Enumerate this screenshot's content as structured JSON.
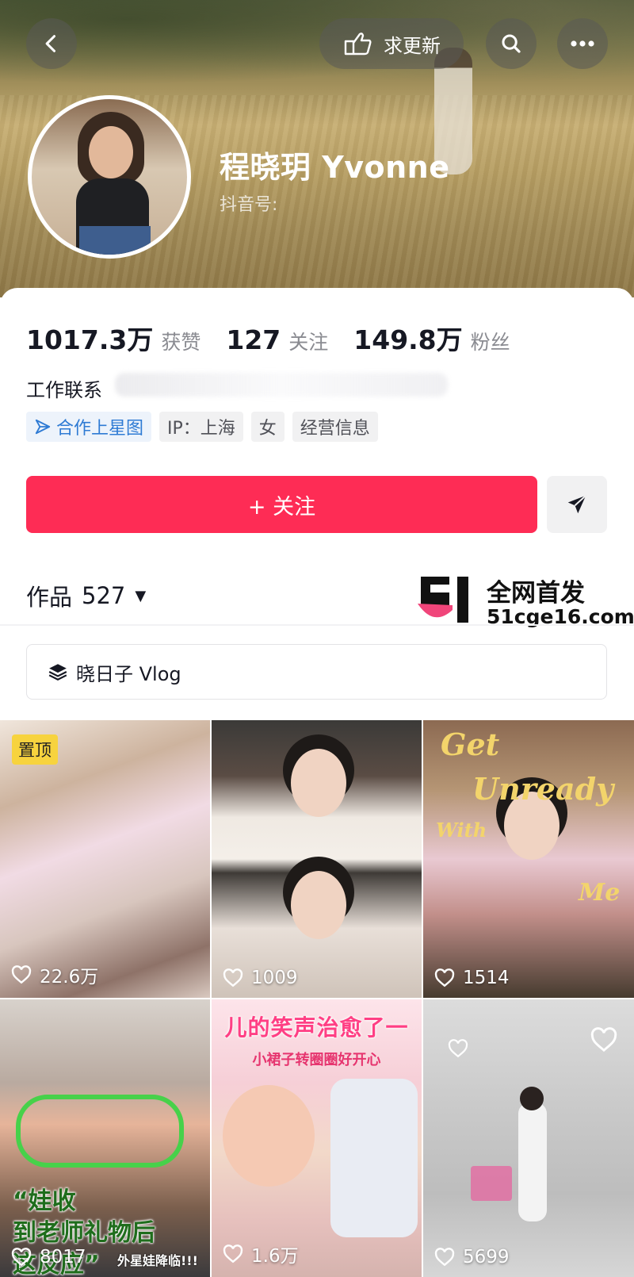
{
  "header": {
    "update_label": "求更新",
    "username": "程晓玥 Yvonne",
    "douyin_id_label": "抖音号:"
  },
  "stats": [
    {
      "num": "1017.3万",
      "unit": "获赞"
    },
    {
      "num": "127",
      "unit": "关注"
    },
    {
      "num": "149.8万",
      "unit": "粉丝"
    }
  ],
  "contact_label": "工作联系",
  "tags": [
    "合作上星图",
    "IP：上海",
    "女",
    "经营信息"
  ],
  "follow_label": "+ 关注",
  "works": {
    "label": "作品",
    "count": "527"
  },
  "watermark": {
    "text1": "全网首发",
    "text2": "51cge16.com"
  },
  "playlist_label": "晓日子 Vlog",
  "videos": [
    {
      "likes": "22.6万",
      "pinned_label": "置顶"
    },
    {
      "likes": "1009"
    },
    {
      "likes": "1514",
      "title_lines": [
        "Get",
        "Unready",
        "With",
        "Me"
      ]
    },
    {
      "likes": "8017",
      "title": "“娃收\n到老师礼物后\n这反应”",
      "subtitle": "外星娃降临!!!"
    },
    {
      "likes": "1.6万",
      "title": "儿的笑声治愈了一",
      "subtitle": "小裙子转圈圈好开心"
    },
    {
      "likes": "5699"
    }
  ],
  "colors": {
    "accent": "#fe2c55",
    "star_tag": "#2f7bd4",
    "pin": "#f7d33e"
  }
}
